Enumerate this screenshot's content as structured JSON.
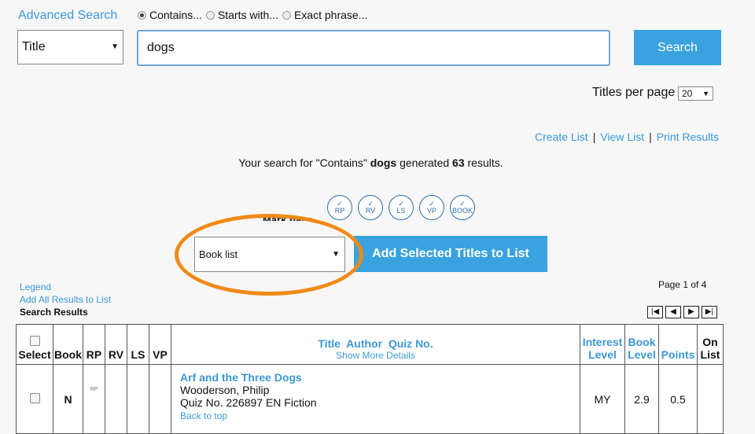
{
  "header": {
    "title": "Advanced Search"
  },
  "search_mode": {
    "options": [
      "Contains...",
      "Starts with...",
      "Exact phrase..."
    ],
    "selected": "Contains..."
  },
  "search": {
    "field": "Title",
    "query": "dogs",
    "button": "Search"
  },
  "titles_per_page": {
    "label": "Titles per page",
    "value": "20"
  },
  "list_links": {
    "create": "Create List",
    "view": "View List",
    "print": "Print Results",
    "separator": "|"
  },
  "summary": {
    "prefix": "Your search for \"Contains\"",
    "term": "dogs",
    "middle": "generated",
    "count": "63",
    "suffix": "results."
  },
  "mark_have": {
    "label": "Mark have",
    "icons": [
      "RP",
      "RV",
      "LS",
      "VP",
      "BOOK"
    ],
    "check": "✓"
  },
  "list_select": {
    "value": "Book list"
  },
  "add_button": "Add Selected Titles to List",
  "legend": "Legend",
  "add_all": "Add All Results to List",
  "search_results_label": "Search Results",
  "pagination": {
    "text": "Page 1 of 4"
  },
  "table": {
    "headers": {
      "select": "Select",
      "book": "Book",
      "rp": "RP",
      "rv": "RV",
      "ls": "LS",
      "vp": "VP",
      "title": "Title",
      "author": "Author",
      "quiz": "Quiz No.",
      "more": "Show More Details",
      "interest": "Interest",
      "interest2": "Level",
      "booklevel": "Book",
      "booklevel2": "Level",
      "points": "Points",
      "onlist": "On",
      "onlist2": "List"
    },
    "rows": [
      {
        "book": "N",
        "rp_mark": "RP",
        "title": "Arf and the Three Dogs",
        "author": "Wooderson, Philip",
        "quiz": "Quiz No. 226897 EN Fiction",
        "back_to_top": "Back to top",
        "interest_level": "MY",
        "book_level": "2.9",
        "points": "0.5"
      }
    ]
  },
  "colors": {
    "accent": "#3aa3df",
    "link": "#3a98d8",
    "highlight_ring": "#f08a17"
  }
}
